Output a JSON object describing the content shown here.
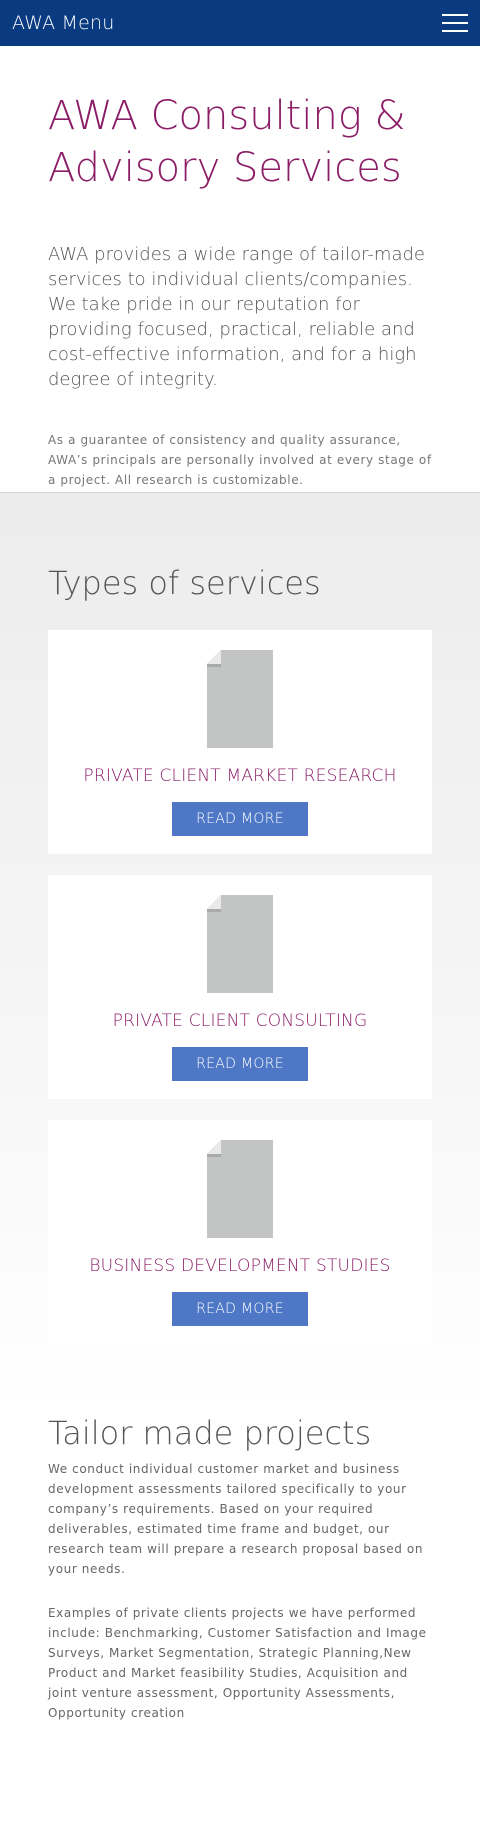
{
  "header": {
    "brand": "AWA Menu",
    "menu_icon": "hamburger-icon"
  },
  "intro": {
    "title": "AWA Consulting & Advisory Services",
    "lead": "AWA provides a wide range of tailor-made services to individual clients/companies. We take pride in our reputation for providing focused, practical, reliable and cost-effective information, and for a high degree of integrity.",
    "note": "As a guarantee of consistency and quality assurance, AWA’s principals are personally involved at every stage of a project. All research is customizable."
  },
  "services": {
    "heading": "Types of services",
    "icon": "document-icon",
    "items": [
      {
        "title": "PRIVATE CLIENT MARKET RESEARCH",
        "button": "READ MORE"
      },
      {
        "title": "PRIVATE CLIENT CONSULTING",
        "button": "READ MORE"
      },
      {
        "title": "BUSINESS DEVELOPMENT STUDIES",
        "button": "READ MORE"
      }
    ]
  },
  "tailor": {
    "heading": "Tailor made projects",
    "p1": "We conduct individual customer market and business development assessments tailored specifically to your company’s requirements. Based on your required deliverables, estimated time frame and budget, our research team will prepare a research proposal based on your needs.",
    "p2": "Examples of private clients projects we have performed include: Benchmarking, Customer Satisfaction and Image Surveys, Market Segmentation, Strategic Planning,New Product and Market feasibility Studies, Acquisition and joint venture assessment, Opportunity Assessments, Opportunity creation"
  },
  "colors": {
    "header_bg": "#0a3a80",
    "accent": "#8b1d67",
    "button_bg": "#4e78c6",
    "doc_icon": "#c3c4c4"
  }
}
